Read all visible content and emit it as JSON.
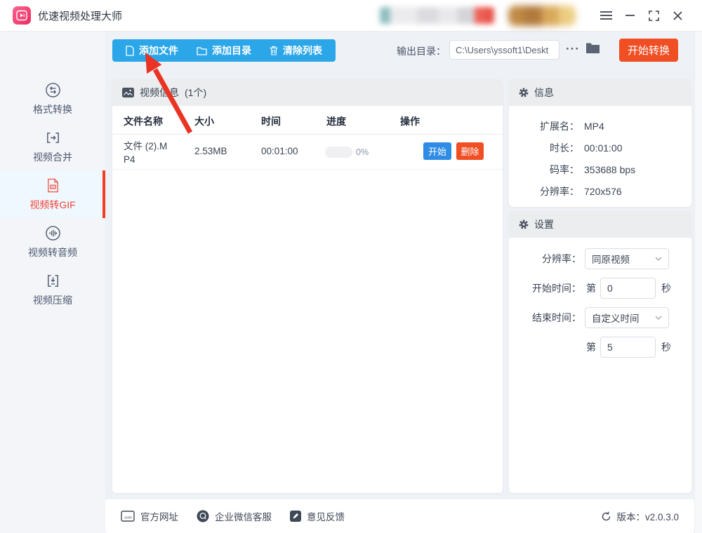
{
  "titlebar": {
    "app_title": "优速视频处理大师"
  },
  "toolbar": {
    "add_file_label": "添加文件",
    "add_dir_label": "添加目录",
    "clear_list_label": "清除列表",
    "output_label": "输出目录：",
    "output_path": "C:\\Users\\yssoft1\\Deskt",
    "more_label": "···",
    "start_convert_label": "开始转换"
  },
  "sidebar": {
    "items": [
      {
        "label": "格式转换",
        "active": false
      },
      {
        "label": "视频合并",
        "active": false
      },
      {
        "label": "视频转GIF",
        "active": true
      },
      {
        "label": "视频转音频",
        "active": false
      },
      {
        "label": "视频压缩",
        "active": false
      }
    ]
  },
  "file_list": {
    "section_title": "视频信息",
    "count_text": "(1个)",
    "columns": [
      "文件名称",
      "大小",
      "时间",
      "进度",
      "操作"
    ],
    "rows": [
      {
        "name": "文件 (2).MP4",
        "size": "2.53MB",
        "time": "00:01:00",
        "progress_pct": "0%",
        "start_label": "开始",
        "delete_label": "删除"
      }
    ]
  },
  "info_panel": {
    "title": "信息",
    "fields": [
      {
        "label": "扩展名：",
        "value": "MP4"
      },
      {
        "label": "时长：",
        "value": "00:01:00"
      },
      {
        "label": "码率：",
        "value": "353688 bps"
      },
      {
        "label": "分辨率：",
        "value": "720x576"
      }
    ]
  },
  "settings_panel": {
    "title": "设置",
    "resolution_label": "分辨率：",
    "resolution_value": "同原视频",
    "start_time_label": "开始时间：",
    "start_prefix": "第",
    "start_value": "0",
    "start_suffix": "秒",
    "end_time_label": "结束时间：",
    "end_mode_value": "自定义时间",
    "end_prefix": "第",
    "end_value": "5",
    "end_suffix": "秒"
  },
  "footer": {
    "links": [
      "官方网址",
      "企业微信客服",
      "意见反馈"
    ],
    "version_text": "版本：v2.0.3.0"
  },
  "colors": {
    "toolbar_blue": "#2ba6e9",
    "start_button_red": "#f04e23",
    "row_start_blue": "#2f8ce4",
    "active_item_red": "#f4453a",
    "header_bar_gray": "#ebedef",
    "logo_pink": "#ee2a5e"
  }
}
